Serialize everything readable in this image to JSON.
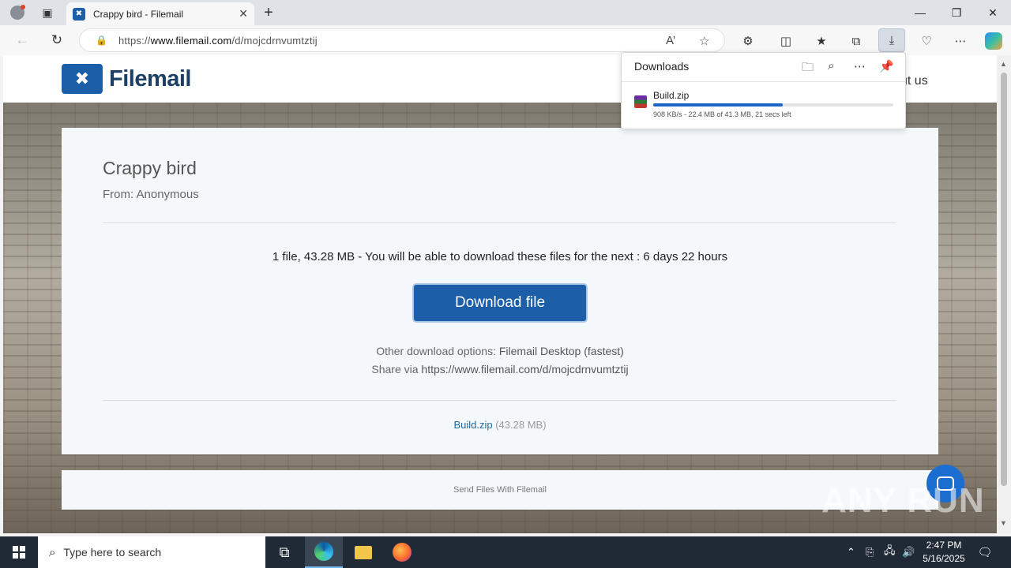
{
  "browser": {
    "tab_title": "Crappy bird - Filemail",
    "url_prefix": "https://",
    "url_host": "www.filemail.com",
    "url_path": "/d/mojcdrnvumtztij",
    "new_tab_glyph": "+",
    "accent": "#1c5fa8"
  },
  "site": {
    "logo_text": "Filemail",
    "nav_about": "ut us"
  },
  "card": {
    "title": "Crappy bird",
    "from": "From: Anonymous",
    "summary": "1 file, 43.28 MB - You will be able to download these files for the next : 6 days 22 hours",
    "download_button": "Download file",
    "other_options_prefix": "Other download options: ",
    "other_options_link": "Filemail Desktop (fastest)",
    "share_prefix": "Share via ",
    "share_url": "https://www.filemail.com/d/mojcdrnvumtztij",
    "file_name": "Build.zip",
    "file_size": "(43.28 MB)"
  },
  "footer": {
    "text": "Send Files With Filemail"
  },
  "watermark": "ANY RUN",
  "downloads_panel": {
    "title": "Downloads",
    "item_name": "Build.zip",
    "status": "908 KB/s - 22.4 MB of 41.3 MB, 21 secs left",
    "progress_fraction": 0.54
  },
  "taskbar": {
    "search_placeholder": "Type here to search",
    "time": "2:47 PM",
    "date": "5/16/2025"
  }
}
